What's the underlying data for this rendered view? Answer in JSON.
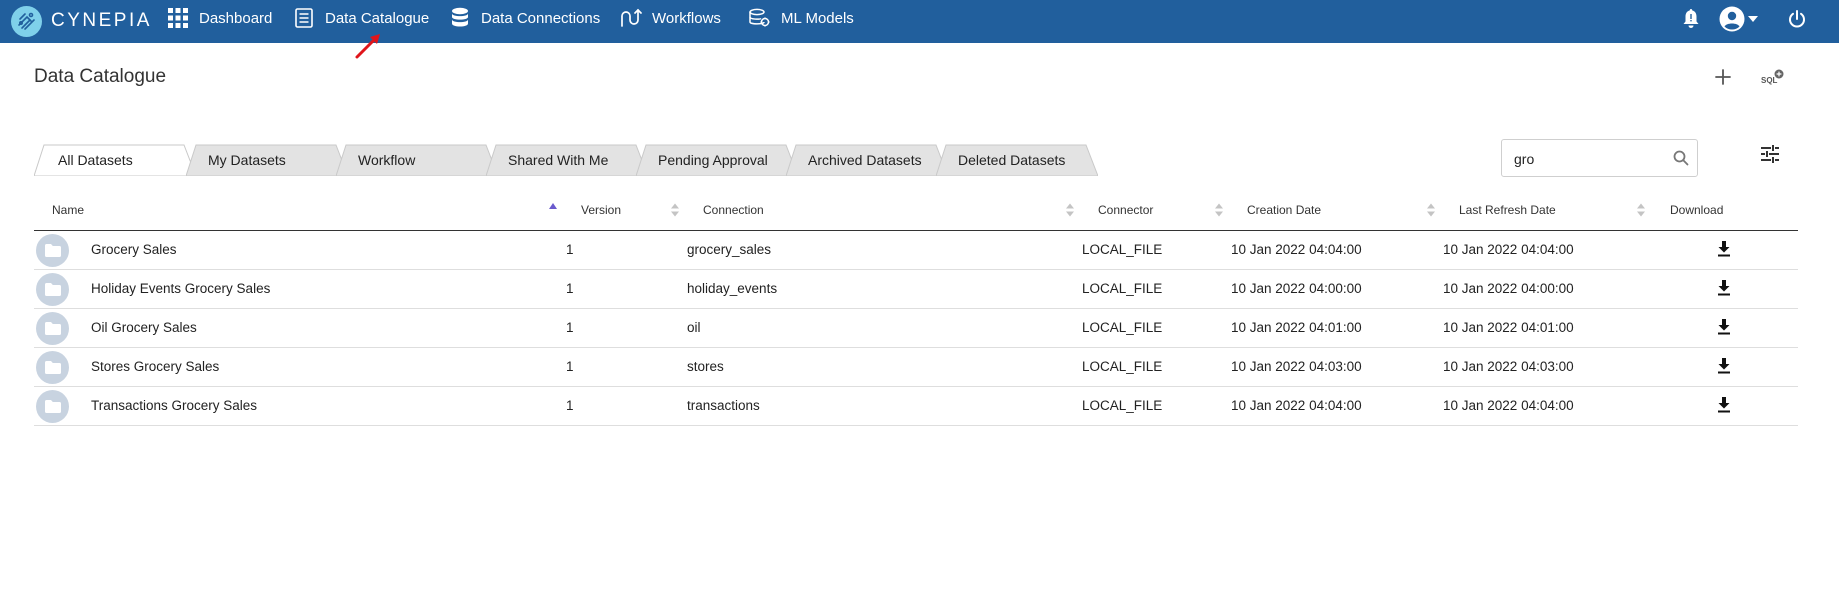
{
  "brand": {
    "name": "CYNEPIA"
  },
  "nav": {
    "items": [
      {
        "label": "Dashboard",
        "icon": "grid-icon"
      },
      {
        "label": "Data Catalogue",
        "icon": "document-list-icon"
      },
      {
        "label": "Data Connections",
        "icon": "database-icon"
      },
      {
        "label": "Workflows",
        "icon": "workflow-icon"
      },
      {
        "label": "ML Models",
        "icon": "ml-model-icon"
      }
    ],
    "right_icons": [
      "bell-icon",
      "account-icon",
      "chevron-down-icon",
      "power-icon"
    ]
  },
  "page": {
    "title": "Data Catalogue",
    "sql_label": "SQL"
  },
  "tabs": [
    {
      "label": "All Datasets",
      "active": true
    },
    {
      "label": "My Datasets",
      "active": false
    },
    {
      "label": "Workflow",
      "active": false
    },
    {
      "label": "Shared With Me",
      "active": false
    },
    {
      "label": "Pending Approval",
      "active": false
    },
    {
      "label": "Archived Datasets",
      "active": false
    },
    {
      "label": "Deleted Datasets",
      "active": false
    }
  ],
  "search": {
    "value": "gro",
    "placeholder": ""
  },
  "table": {
    "columns": [
      "Name",
      "Version",
      "Connection",
      "Connector",
      "Creation Date",
      "Last Refresh Date",
      "Download"
    ],
    "rows": [
      {
        "name": "Grocery Sales",
        "version": "1",
        "connection": "grocery_sales",
        "connector": "LOCAL_FILE",
        "created": "10 Jan 2022 04:04:00",
        "refreshed": "10 Jan 2022 04:04:00"
      },
      {
        "name": "Holiday Events Grocery Sales",
        "version": "1",
        "connection": "holiday_events",
        "connector": "LOCAL_FILE",
        "created": "10 Jan 2022 04:00:00",
        "refreshed": "10 Jan 2022 04:00:00"
      },
      {
        "name": "Oil Grocery Sales",
        "version": "1",
        "connection": "oil",
        "connector": "LOCAL_FILE",
        "created": "10 Jan 2022 04:01:00",
        "refreshed": "10 Jan 2022 04:01:00"
      },
      {
        "name": "Stores Grocery Sales",
        "version": "1",
        "connection": "stores",
        "connector": "LOCAL_FILE",
        "created": "10 Jan 2022 04:03:00",
        "refreshed": "10 Jan 2022 04:03:00"
      },
      {
        "name": "Transactions Grocery Sales",
        "version": "1",
        "connection": "transactions",
        "connector": "LOCAL_FILE",
        "created": "10 Jan 2022 04:04:00",
        "refreshed": "10 Jan 2022 04:04:00"
      }
    ]
  },
  "colors": {
    "topbar": "#215f9d",
    "logo_accent": "#7fd0ea",
    "annotation_arrow": "#e0151b",
    "sort_active": "#6a5acd",
    "folder_bg": "#c8d3e0"
  }
}
